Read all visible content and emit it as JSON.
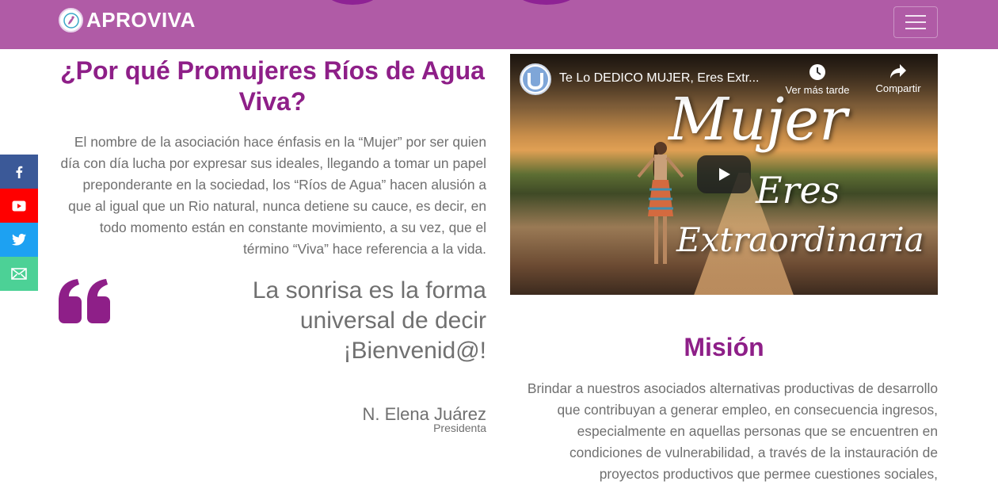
{
  "navbar": {
    "brand": "APROVIVA",
    "menu_icon": "hamburger-icon"
  },
  "social": [
    {
      "name": "facebook",
      "icon": "facebook-icon",
      "color": "#3b5998"
    },
    {
      "name": "youtube",
      "icon": "youtube-icon",
      "color": "#ff0000"
    },
    {
      "name": "twitter",
      "icon": "twitter-icon",
      "color": "#1da1f2"
    },
    {
      "name": "email",
      "icon": "mail-icon",
      "color": "#4cd196"
    }
  ],
  "intro": {
    "title": "¿Por qué Promujeres Ríos de Agua Viva?",
    "text": "El nombre de la asociación hace énfasis en la “Mujer” por ser quien día con día lucha por expresar sus ideales, llegando a tomar un papel preponderante en la sociedad, los “Ríos de Agua” hacen alusión a que al igual que un Rio natural, nunca detiene su cauce, es decir, en todo momento están en constante movimiento, a su vez, que el término “Viva” hace referencia a la vida."
  },
  "quote": {
    "text": "La sonrisa es la forma universal de decir ¡Bienvenid@!",
    "author": "N. Elena Juárez",
    "role": "Presidenta"
  },
  "video": {
    "title": "Te Lo DEDICO MUJER, Eres Extr...",
    "watch_later": "Ver más tarde",
    "share": "Compartir",
    "overlay_line1": "Mujer",
    "overlay_line2": "Eres",
    "overlay_line3": "Extraordinaria"
  },
  "mission": {
    "title": "Misión",
    "text": "Brindar a nuestros asociados alternativas productivas de desarrollo que contribuyan a generar empleo, en consecuencia ingresos, especialmente en aquellas personas que se encuentren en condiciones de vulnerabilidad, a través de la instauración de proyectos productivos que permee cuestiones sociales,"
  },
  "colors": {
    "navbar": "#b05ba6",
    "accent": "#8e1f88"
  }
}
